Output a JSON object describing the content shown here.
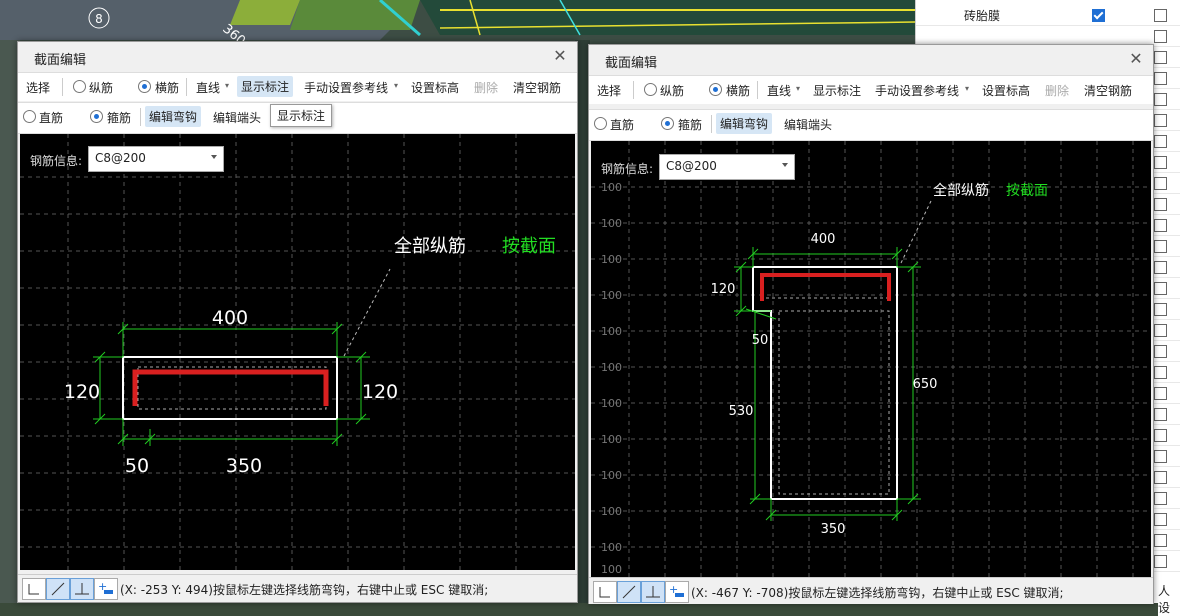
{
  "background": {
    "grid_label": "8",
    "dim_label": "360"
  },
  "right_panel": {
    "row_label": "砖胎膜",
    "right_edge_text": "人设"
  },
  "dialog_left": {
    "title": "截面编辑",
    "toolbar1": {
      "select": "选择",
      "longitudinal": "纵筋",
      "transverse": "横筋",
      "line": "直线",
      "show_annotation": "显示标注",
      "manual_ref": "手动设置参考线",
      "set_elevation": "设置标高",
      "delete": "删除",
      "clear": "清空钢筋"
    },
    "toolbar2": {
      "straight": "直筋",
      "stirrup": "箍筋",
      "edit_hook": "编辑弯钩",
      "edit_end": "编辑端头"
    },
    "tooltip": "显示标注",
    "rebar_info_label": "钢筋信息:",
    "rebar_info_value": "C8@200",
    "annotation_all": "全部纵筋",
    "annotation_section": "按截面",
    "dims": {
      "top": "400",
      "left": "120",
      "right": "120",
      "bottom_left": "50",
      "bottom": "350"
    },
    "status_text": "(X: -253 Y: 494)按鼠标左键选择线筋弯钩，右键中止或 ESC 键取消;"
  },
  "dialog_right": {
    "title": "截面编辑",
    "toolbar1": {
      "select": "选择",
      "longitudinal": "纵筋",
      "transverse": "横筋",
      "line": "直线",
      "show_annotation": "显示标注",
      "manual_ref": "手动设置参考线",
      "set_elevation": "设置标高",
      "delete": "删除",
      "clear": "清空钢筋"
    },
    "toolbar2": {
      "straight": "直筋",
      "stirrup": "箍筋",
      "edit_hook": "编辑弯钩",
      "edit_end": "编辑端头"
    },
    "rebar_info_label": "钢筋信息:",
    "rebar_info_value": "C8@200",
    "annotation_all": "全部纵筋",
    "annotation_section": "按截面",
    "grid_labels": [
      "100",
      "100",
      "100",
      "100",
      "100",
      "100",
      "100",
      "100",
      "100",
      "100",
      "100",
      "100"
    ],
    "dims": {
      "top": "400",
      "left_top": "120",
      "left_mid": "50",
      "left_bottom": "530",
      "right": "650",
      "bottom": "350"
    },
    "status_text": "(X: -467 Y: -708)按鼠标左键选择线筋弯钩，右键中止或 ESC 键取消;"
  },
  "colors": {
    "rebar": "#d92020",
    "dim": "#22cc22",
    "section_label": "#22dd22"
  }
}
